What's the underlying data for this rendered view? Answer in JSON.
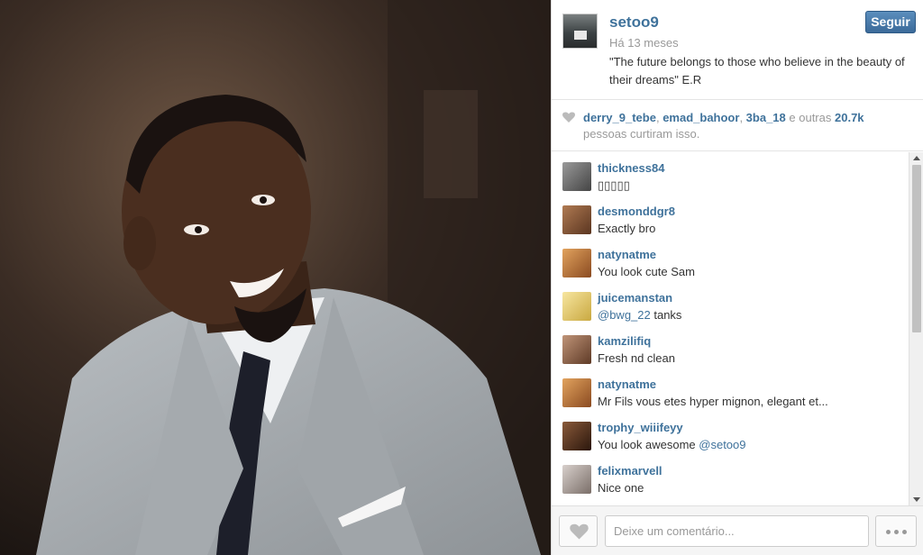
{
  "post": {
    "username": "setoo9",
    "time_ago": "Há 13 meses",
    "caption": "\"The future belongs to those who believe in the beauty of their dreams\" E.R",
    "follow_label": "Seguir"
  },
  "likes": {
    "users": [
      "derry_9_tebe",
      "emad_bahoor",
      "3ba_18"
    ],
    "others_prefix": "e outras",
    "count": "20.7k",
    "suffix": "pessoas curtiram isso."
  },
  "comments": [
    {
      "user": "thickness84",
      "text": "▯▯▯▯▯",
      "avatar_color": "#6b6b6b"
    },
    {
      "user": "desmonddgr8",
      "text": "Exactly bro",
      "avatar_color": "#8a5a3c"
    },
    {
      "user": "natynatme",
      "text": "You look cute Sam",
      "avatar_color": "#c9803e"
    },
    {
      "user": "juicemanstan",
      "mention": "@bwg_22",
      "text": " tanks",
      "avatar_color": "#e7cf7a"
    },
    {
      "user": "kamzilifiq",
      "text": "Fresh nd clean",
      "avatar_color": "#9b6f55"
    },
    {
      "user": "natynatme",
      "text": "Mr Fils vous etes hyper mignon, elegant et...",
      "avatar_color": "#c9803e"
    },
    {
      "user": "trophy_wiiifeyy",
      "text": "You look awesome ",
      "mention_after": "@setoo9",
      "avatar_color": "#4a2a1c"
    },
    {
      "user": "felixmarvell",
      "text": "Nice one",
      "avatar_color": "#b0a8a4"
    }
  ],
  "footer": {
    "comment_placeholder": "Deixe um comentário..."
  },
  "colors": {
    "link": "#3f729b",
    "follow_button": "#3b6a99"
  },
  "icons": [
    "heart-icon",
    "more-options-icon",
    "scroll-up-icon",
    "scroll-down-icon"
  ]
}
